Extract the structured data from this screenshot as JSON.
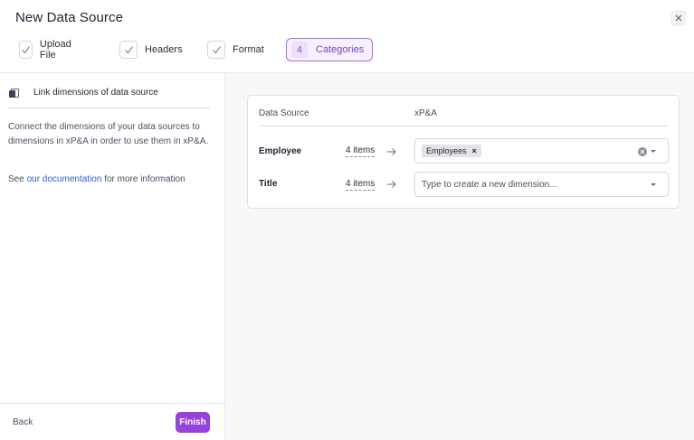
{
  "header": {
    "title": "New Data Source",
    "steps": [
      {
        "label": "Upload File",
        "state": "done"
      },
      {
        "label": "Headers",
        "state": "done"
      },
      {
        "label": "Format",
        "state": "done"
      },
      {
        "number": "4",
        "label": "Categories",
        "state": "active"
      }
    ]
  },
  "sidebar": {
    "heading": "Link dimensions of data source",
    "description": "Connect the dimensions of your data sources to dimensions in xP&A in order to use them in xP&A.",
    "doc_prefix": "See ",
    "doc_link": "our documentation",
    "doc_suffix": " for more information",
    "back_label": "Back",
    "finish_label": "Finish"
  },
  "mapping": {
    "col_source": "Data Source",
    "col_target": "xP&A",
    "rows": [
      {
        "source": "Employee",
        "items": "4 items",
        "chip": "Employees",
        "placeholder": ""
      },
      {
        "source": "Title",
        "items": "4 items",
        "chip": "",
        "placeholder": "Type to create a new dimension..."
      }
    ]
  },
  "colors": {
    "accent": "#9642dc",
    "link": "#2f5fd0"
  }
}
